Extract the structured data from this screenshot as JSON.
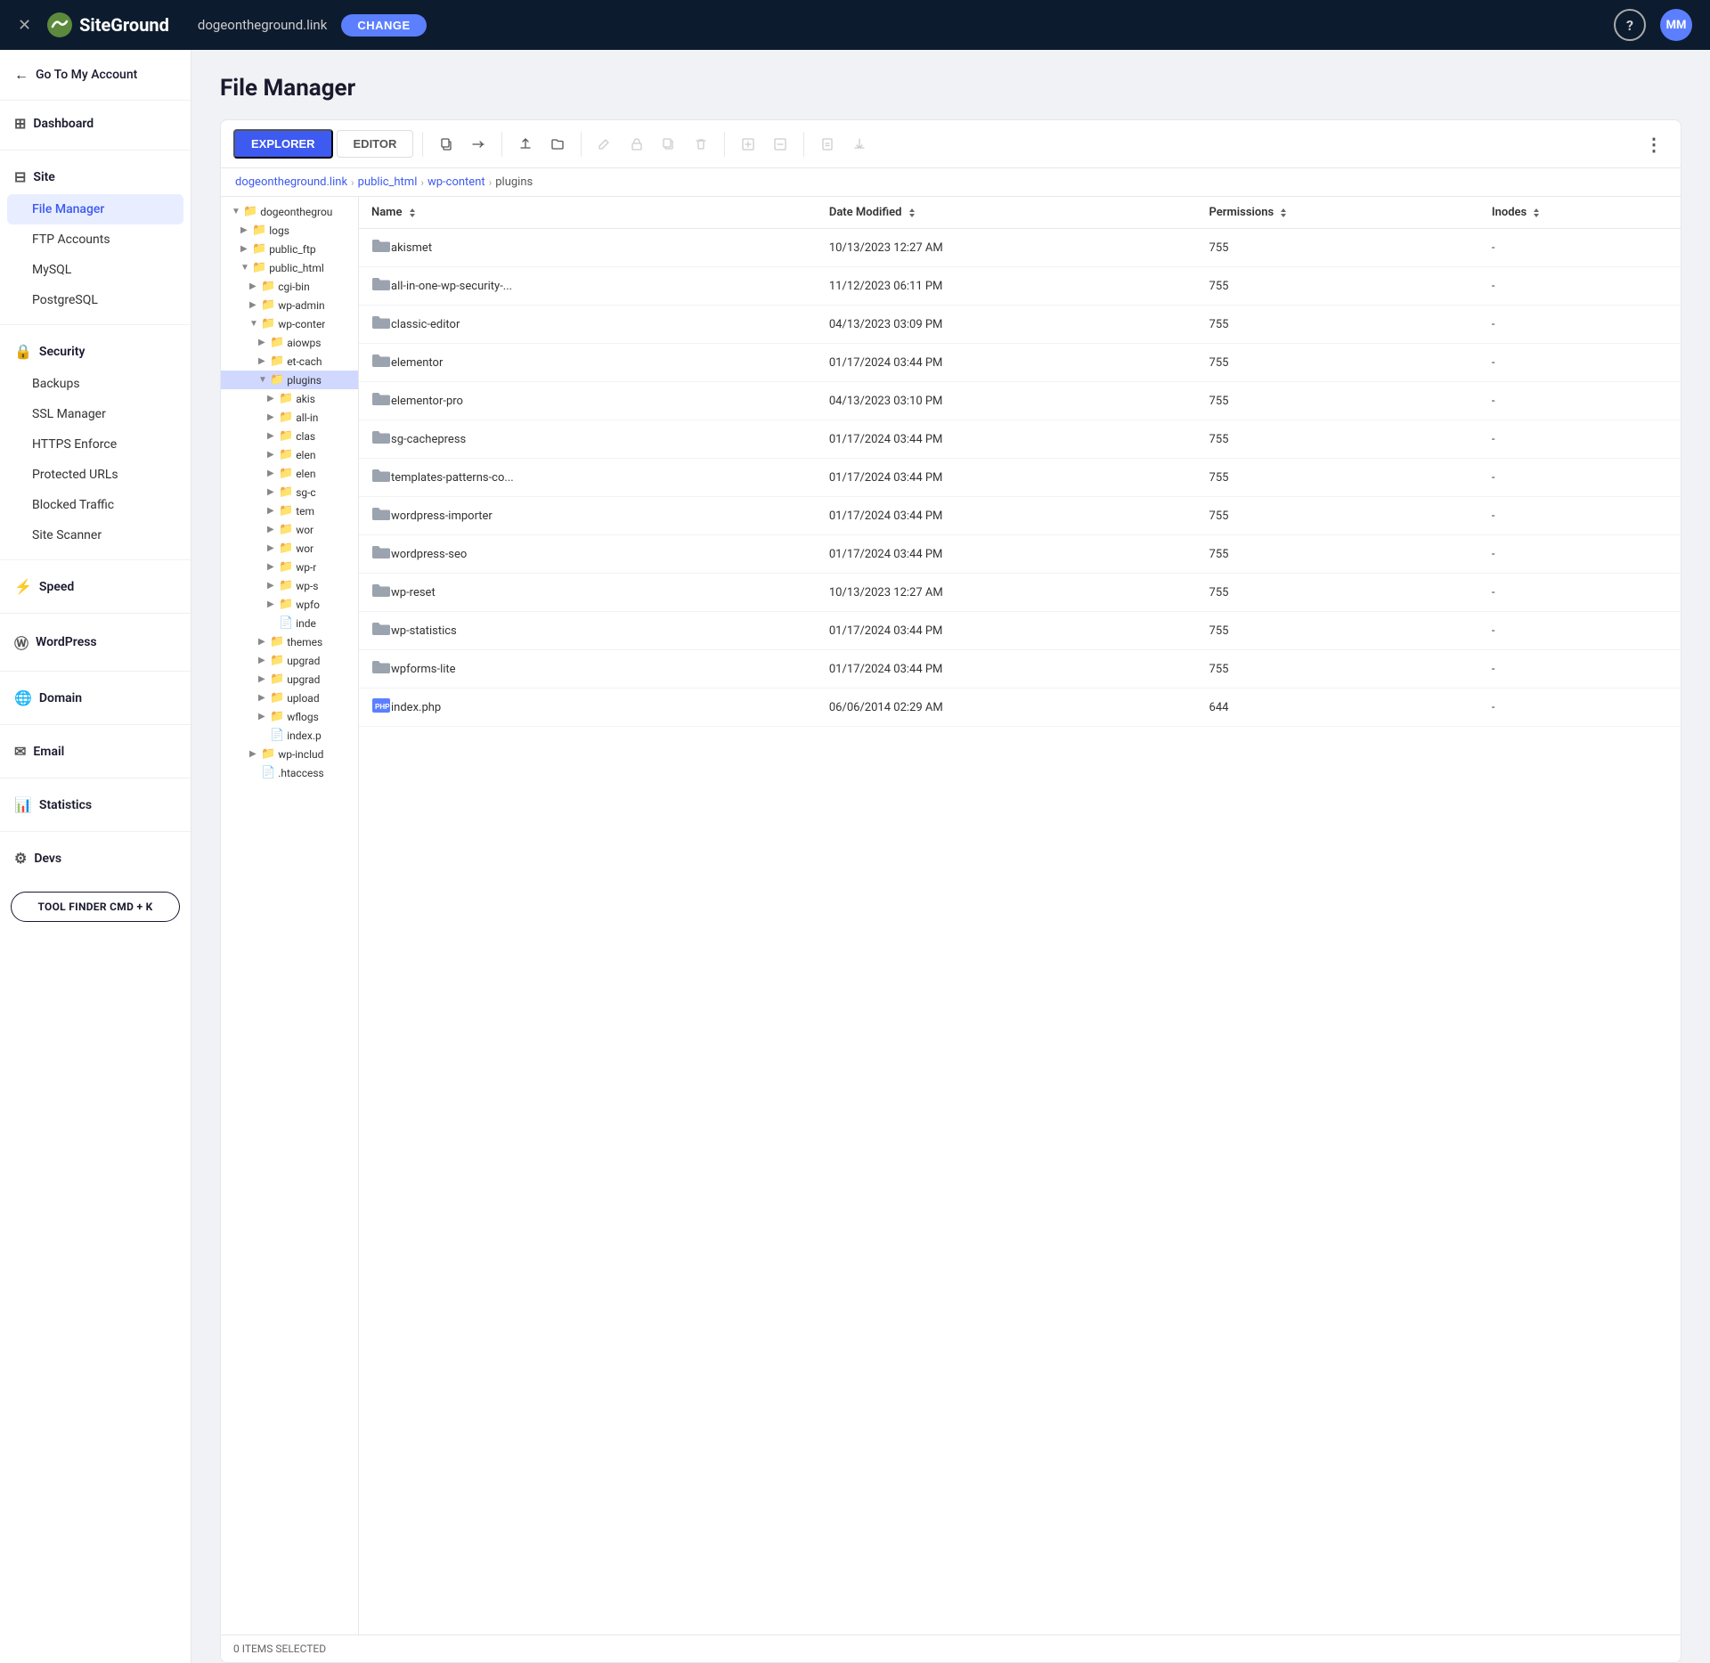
{
  "topbar": {
    "close_icon": "✕",
    "logo_text": "SiteGround",
    "domain": "dogeontheground.link",
    "change_label": "CHANGE",
    "help_label": "?",
    "avatar_label": "MM"
  },
  "sidebar": {
    "back_label": "Go To My Account",
    "sections": [
      {
        "id": "dashboard",
        "label": "Dashboard",
        "icon": "⊞",
        "items": []
      },
      {
        "id": "site",
        "label": "Site",
        "icon": "⊟",
        "items": [
          {
            "id": "file-manager",
            "label": "File Manager",
            "active": true
          },
          {
            "id": "ftp-accounts",
            "label": "FTP Accounts"
          },
          {
            "id": "mysql",
            "label": "MySQL"
          },
          {
            "id": "postgresql",
            "label": "PostgreSQL"
          }
        ]
      },
      {
        "id": "security",
        "label": "Security",
        "icon": "🔒",
        "items": [
          {
            "id": "backups",
            "label": "Backups"
          },
          {
            "id": "ssl-manager",
            "label": "SSL Manager"
          },
          {
            "id": "https-enforce",
            "label": "HTTPS Enforce"
          },
          {
            "id": "protected-urls",
            "label": "Protected URLs"
          },
          {
            "id": "blocked-traffic",
            "label": "Blocked Traffic"
          },
          {
            "id": "site-scanner",
            "label": "Site Scanner"
          }
        ]
      },
      {
        "id": "speed",
        "label": "Speed",
        "icon": "⚡",
        "items": []
      },
      {
        "id": "wordpress",
        "label": "WordPress",
        "icon": "Ⓦ",
        "items": []
      },
      {
        "id": "domain",
        "label": "Domain",
        "icon": "🌐",
        "items": []
      },
      {
        "id": "email",
        "label": "Email",
        "icon": "✉",
        "items": []
      },
      {
        "id": "statistics",
        "label": "Statistics",
        "icon": "📊",
        "items": []
      },
      {
        "id": "devs",
        "label": "Devs",
        "icon": "⚙",
        "items": []
      }
    ],
    "tool_finder_label": "TOOL FINDER CMD + K"
  },
  "main": {
    "page_title": "File Manager",
    "tabs": [
      {
        "id": "explorer",
        "label": "EXPLORER",
        "active": true
      },
      {
        "id": "editor",
        "label": "EDITOR",
        "active": false
      }
    ],
    "breadcrumb": [
      {
        "id": "domain",
        "label": "dogeontheground.link"
      },
      {
        "id": "public_html",
        "label": "public_html"
      },
      {
        "id": "wp-content",
        "label": "wp-content"
      },
      {
        "id": "plugins",
        "label": "plugins",
        "current": true
      }
    ],
    "tree": [
      {
        "id": "dogeontheground",
        "label": "dogeonthegrou",
        "level": 0,
        "expanded": true,
        "type": "folder"
      },
      {
        "id": "logs",
        "label": "logs",
        "level": 1,
        "expanded": false,
        "type": "folder"
      },
      {
        "id": "public_ftp",
        "label": "public_ftp",
        "level": 1,
        "expanded": false,
        "type": "folder"
      },
      {
        "id": "public_html",
        "label": "public_html",
        "level": 1,
        "expanded": true,
        "type": "folder"
      },
      {
        "id": "cgi-bin",
        "label": "cgi-bin",
        "level": 2,
        "expanded": false,
        "type": "folder"
      },
      {
        "id": "wp-admin",
        "label": "wp-admin",
        "level": 2,
        "expanded": false,
        "type": "folder"
      },
      {
        "id": "wp-content",
        "label": "wp-conter",
        "level": 2,
        "expanded": true,
        "type": "folder"
      },
      {
        "id": "aiowps",
        "label": "aiowps",
        "level": 3,
        "expanded": false,
        "type": "folder"
      },
      {
        "id": "et-cach",
        "label": "et-cach",
        "level": 3,
        "expanded": false,
        "type": "folder"
      },
      {
        "id": "plugins",
        "label": "plugins",
        "level": 3,
        "expanded": true,
        "type": "folder",
        "selected": true
      },
      {
        "id": "akis",
        "label": "akis",
        "level": 4,
        "expanded": false,
        "type": "folder"
      },
      {
        "id": "all-in",
        "label": "all-in",
        "level": 4,
        "expanded": false,
        "type": "folder"
      },
      {
        "id": "clas",
        "label": "clas",
        "level": 4,
        "expanded": false,
        "type": "folder"
      },
      {
        "id": "elen",
        "label": "elen",
        "level": 4,
        "expanded": false,
        "type": "folder"
      },
      {
        "id": "elen2",
        "label": "elen",
        "level": 4,
        "expanded": false,
        "type": "folder"
      },
      {
        "id": "sg-c",
        "label": "sg-c",
        "level": 4,
        "expanded": false,
        "type": "folder"
      },
      {
        "id": "tem",
        "label": "tem",
        "level": 4,
        "expanded": false,
        "type": "folder"
      },
      {
        "id": "wor1",
        "label": "wor",
        "level": 4,
        "expanded": false,
        "type": "folder"
      },
      {
        "id": "wor2",
        "label": "wor",
        "level": 4,
        "expanded": false,
        "type": "folder"
      },
      {
        "id": "wp-r",
        "label": "wp-r",
        "level": 4,
        "expanded": false,
        "type": "folder"
      },
      {
        "id": "wp-s",
        "label": "wp-s",
        "level": 4,
        "expanded": false,
        "type": "folder"
      },
      {
        "id": "wpfo",
        "label": "wpfo",
        "level": 4,
        "expanded": false,
        "type": "folder"
      },
      {
        "id": "index_p",
        "label": "inde",
        "level": 4,
        "expanded": false,
        "type": "file"
      },
      {
        "id": "themes",
        "label": "themes",
        "level": 3,
        "expanded": false,
        "type": "folder"
      },
      {
        "id": "upgrad1",
        "label": "upgrad",
        "level": 3,
        "expanded": false,
        "type": "folder"
      },
      {
        "id": "upgrad2",
        "label": "upgrad",
        "level": 3,
        "expanded": false,
        "type": "folder"
      },
      {
        "id": "upload",
        "label": "upload",
        "level": 3,
        "expanded": false,
        "type": "folder"
      },
      {
        "id": "wflogs",
        "label": "wflogs",
        "level": 3,
        "expanded": false,
        "type": "folder"
      },
      {
        "id": "index_php2",
        "label": "index.p",
        "level": 3,
        "expanded": false,
        "type": "file"
      },
      {
        "id": "wp-includ",
        "label": "wp-includ",
        "level": 2,
        "expanded": false,
        "type": "folder"
      },
      {
        "id": "htaccess",
        "label": ".htaccess",
        "level": 2,
        "expanded": false,
        "type": "file"
      }
    ],
    "table_headers": [
      {
        "id": "name",
        "label": "Name"
      },
      {
        "id": "date_modified",
        "label": "Date Modified"
      },
      {
        "id": "permissions",
        "label": "Permissions"
      },
      {
        "id": "inodes",
        "label": "Inodes"
      }
    ],
    "files": [
      {
        "id": "akismet",
        "name": "akismet",
        "type": "folder",
        "date_modified": "10/13/2023 12:27 AM",
        "permissions": "755",
        "inodes": "-"
      },
      {
        "id": "all-in-one-wp-security",
        "name": "all-in-one-wp-security-...",
        "type": "folder",
        "date_modified": "11/12/2023 06:11 PM",
        "permissions": "755",
        "inodes": "-"
      },
      {
        "id": "classic-editor",
        "name": "classic-editor",
        "type": "folder",
        "date_modified": "04/13/2023 03:09 PM",
        "permissions": "755",
        "inodes": "-"
      },
      {
        "id": "elementor",
        "name": "elementor",
        "type": "folder",
        "date_modified": "01/17/2024 03:44 PM",
        "permissions": "755",
        "inodes": "-"
      },
      {
        "id": "elementor-pro",
        "name": "elementor-pro",
        "type": "folder",
        "date_modified": "04/13/2023 03:10 PM",
        "permissions": "755",
        "inodes": "-"
      },
      {
        "id": "sg-cachepress",
        "name": "sg-cachepress",
        "type": "folder",
        "date_modified": "01/17/2024 03:44 PM",
        "permissions": "755",
        "inodes": "-"
      },
      {
        "id": "templates-patterns-co",
        "name": "templates-patterns-co...",
        "type": "folder",
        "date_modified": "01/17/2024 03:44 PM",
        "permissions": "755",
        "inodes": "-"
      },
      {
        "id": "wordpress-importer",
        "name": "wordpress-importer",
        "type": "folder",
        "date_modified": "01/17/2024 03:44 PM",
        "permissions": "755",
        "inodes": "-"
      },
      {
        "id": "wordpress-seo",
        "name": "wordpress-seo",
        "type": "folder",
        "date_modified": "01/17/2024 03:44 PM",
        "permissions": "755",
        "inodes": "-"
      },
      {
        "id": "wp-reset",
        "name": "wp-reset",
        "type": "folder",
        "date_modified": "10/13/2023 12:27 AM",
        "permissions": "755",
        "inodes": "-"
      },
      {
        "id": "wp-statistics",
        "name": "wp-statistics",
        "type": "folder",
        "date_modified": "01/17/2024 03:44 PM",
        "permissions": "755",
        "inodes": "-"
      },
      {
        "id": "wpforms-lite",
        "name": "wpforms-lite",
        "type": "folder",
        "date_modified": "01/17/2024 03:44 PM",
        "permissions": "755",
        "inodes": "-"
      },
      {
        "id": "index-php",
        "name": "index.php",
        "type": "php",
        "date_modified": "06/06/2014 02:29 AM",
        "permissions": "644",
        "inodes": "-"
      }
    ],
    "status_bar": "0 ITEMS SELECTED"
  }
}
